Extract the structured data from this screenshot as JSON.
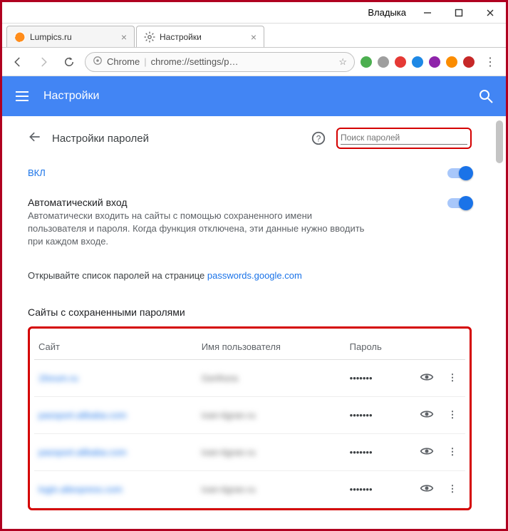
{
  "window": {
    "user": "Владыка"
  },
  "tabs": [
    {
      "title": "Lumpics.ru",
      "active": false
    },
    {
      "title": "Настройки",
      "active": true
    }
  ],
  "omnibox": {
    "scheme": "Chrome",
    "url": "chrome://settings/p…"
  },
  "appbar": {
    "title": "Настройки"
  },
  "page": {
    "header": "Настройки паролей",
    "search_placeholder": "Поиск паролей",
    "on_label": "ВКЛ",
    "auto": {
      "title": "Автоматический вход",
      "desc": "Автоматически входить на сайты с помощью сохраненного имени пользователя и пароля. Когда функция отключена, эти данные нужно вводить при каждом входе."
    },
    "promo_prefix": "Открывайте список паролей на странице ",
    "promo_link": "passwords.google.com",
    "saved_title": "Сайты с сохраненными паролями",
    "columns": {
      "site": "Сайт",
      "user": "Имя пользователя",
      "pass": "Пароль"
    },
    "rows": [
      {
        "site": "1forum.ru",
        "user": "Gerthora",
        "pass": "•••••••"
      },
      {
        "site": "passport.alibaba.com",
        "user": "ivan-tigran.ru",
        "pass": "•••••••"
      },
      {
        "site": "passport.alibaba.com",
        "user": "ivan-tigran.ru",
        "pass": "•••••••"
      },
      {
        "site": "login.aliexpress.com",
        "user": "ivan-tigran.ru",
        "pass": "•••••••"
      }
    ]
  }
}
